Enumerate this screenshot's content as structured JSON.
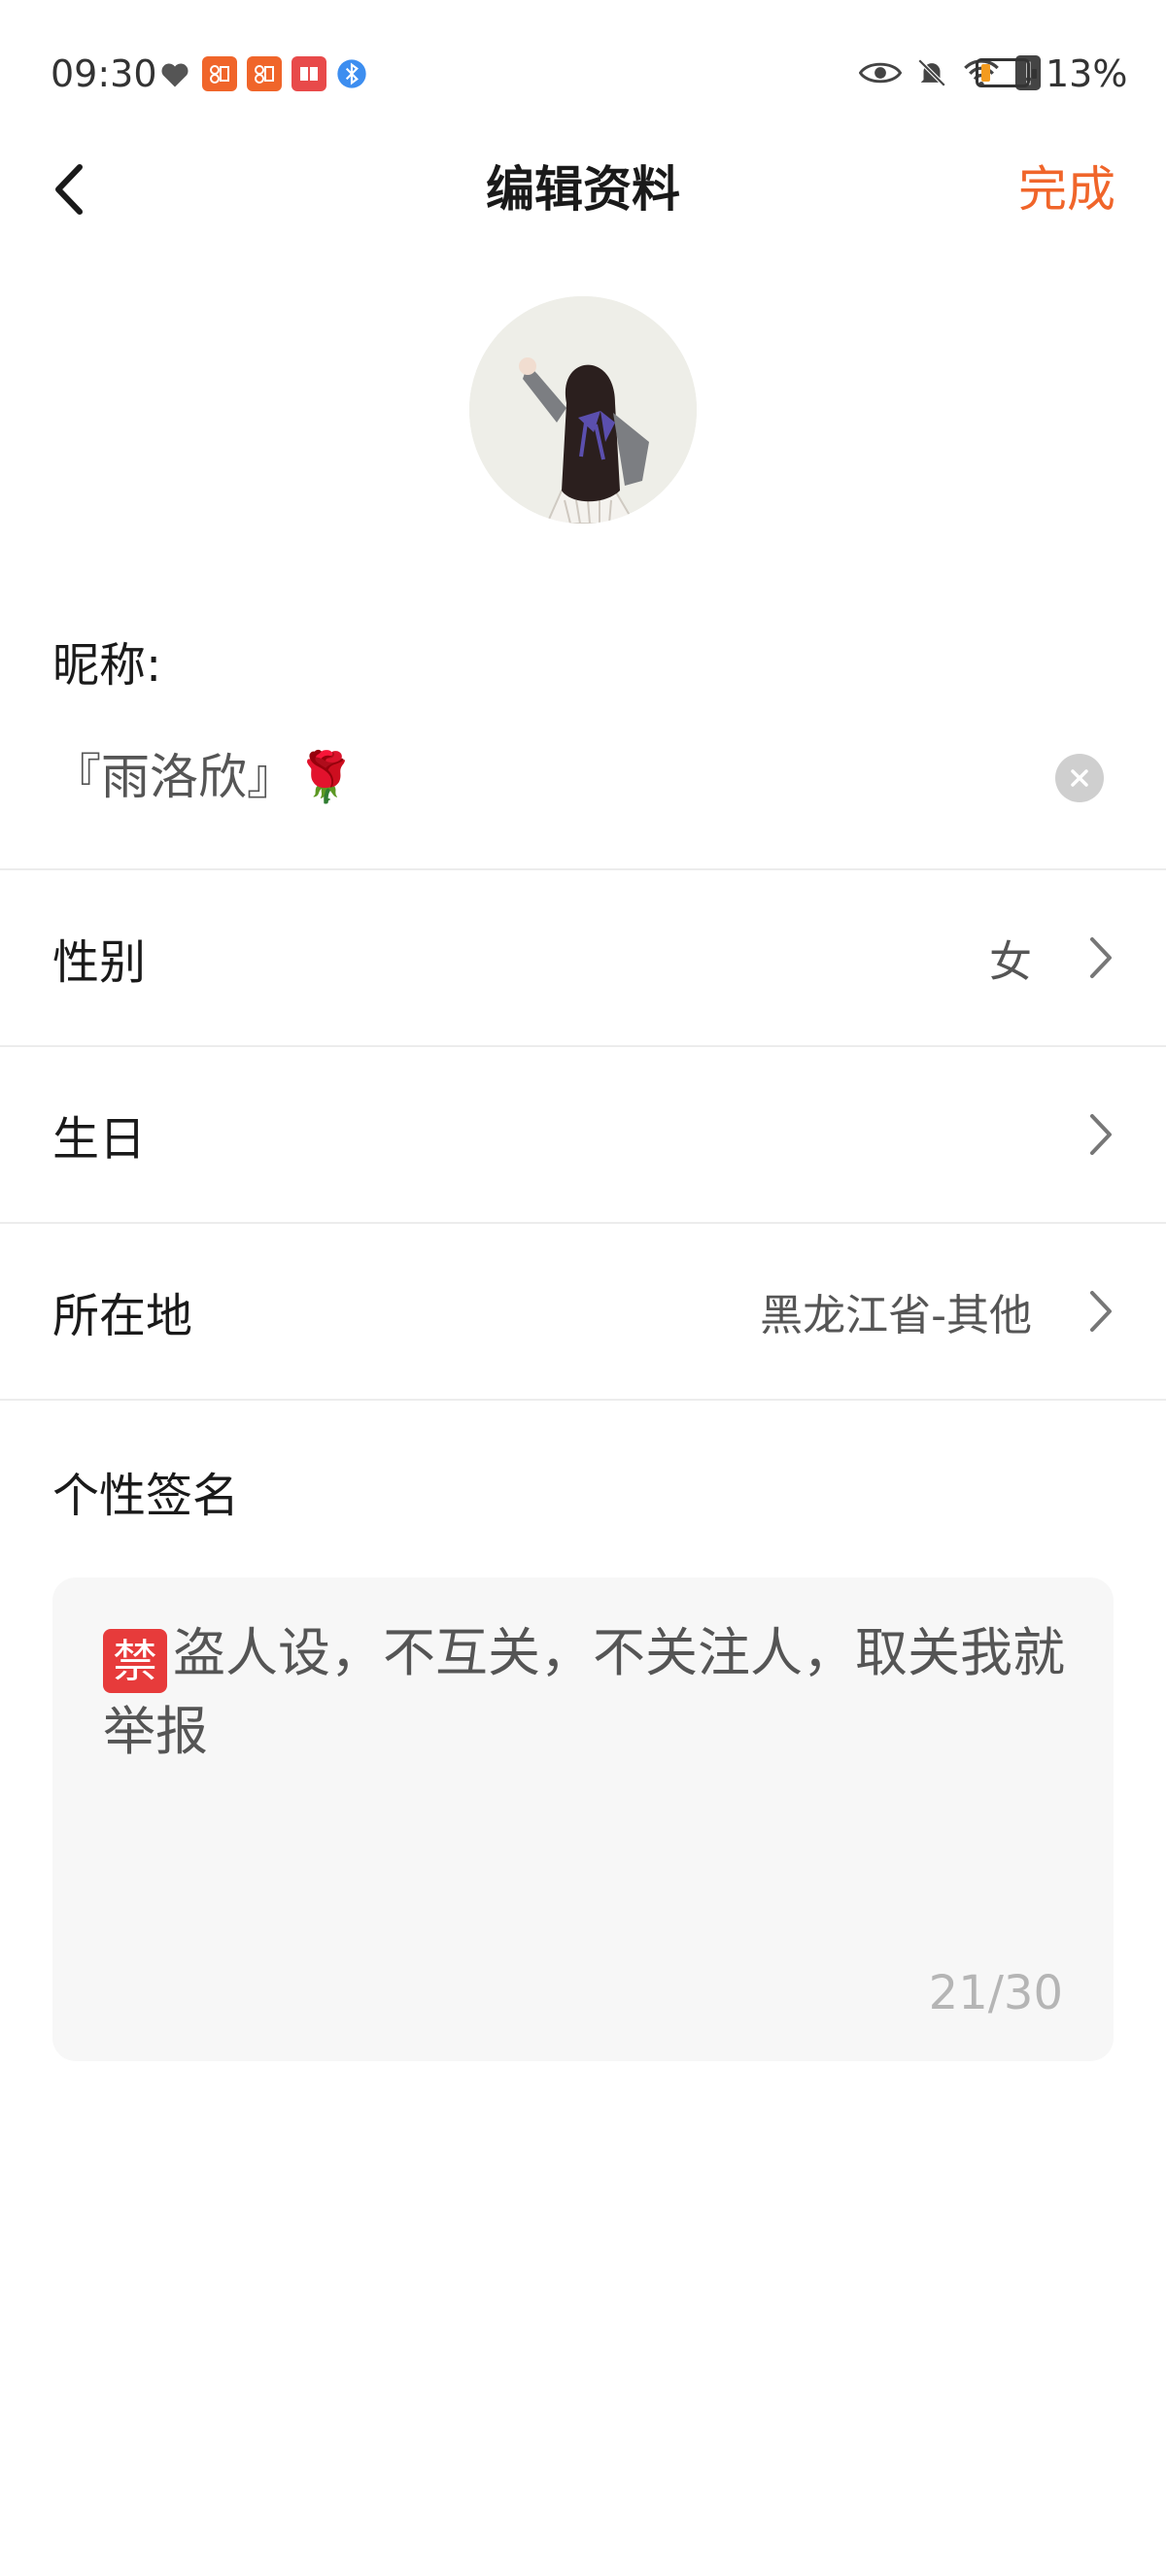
{
  "status_bar": {
    "time": "09:30",
    "battery_percent": "13%",
    "battery_level": 0.13,
    "icons_left": [
      "heart-icon",
      "app-icon",
      "app-icon",
      "book-icon",
      "bluetooth-icon"
    ],
    "icons_right": [
      "eye-icon",
      "bell-off-icon",
      "wifi-icon",
      "alert-icon",
      "battery-icon"
    ]
  },
  "header": {
    "title": "编辑资料",
    "done_label": "完成",
    "accent_color": "#f0652a"
  },
  "nickname": {
    "label": "昵称:",
    "value": "『雨洛欣』🌹"
  },
  "rows": [
    {
      "label": "性别",
      "value": "女"
    },
    {
      "label": "生日",
      "value": ""
    },
    {
      "label": "所在地",
      "value": "黑龙江省-其他"
    }
  ],
  "signature": {
    "label": "个性签名",
    "emoji": "禁",
    "text": "盗人设，不互关，不关注人，取关我就举报",
    "count": "21/30"
  }
}
